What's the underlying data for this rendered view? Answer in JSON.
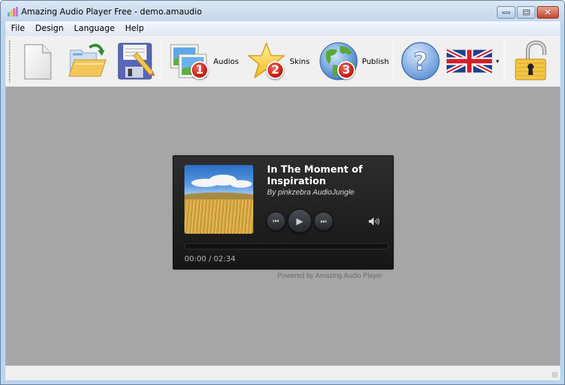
{
  "window": {
    "title": "Amazing Audio Player Free - demo.amaudio",
    "controls": {
      "minimize": "minimize",
      "maximize": "maximize",
      "close": "close"
    }
  },
  "menu": {
    "items": [
      {
        "label": "File"
      },
      {
        "label": "Design"
      },
      {
        "label": "Language"
      },
      {
        "label": "Help"
      }
    ]
  },
  "toolbar": {
    "new_icon": "new-document-icon",
    "open_icon": "open-folder-icon",
    "save_icon": "save-floppy-icon",
    "steps": [
      {
        "label": "Audios",
        "badge": "1",
        "icon": "images-icon"
      },
      {
        "label": "Skins",
        "badge": "2",
        "icon": "star-icon"
      },
      {
        "label": "Publish",
        "badge": "3",
        "icon": "globe-icon"
      }
    ],
    "help_icon": "help-icon",
    "language_icon": "uk-flag-icon",
    "lock_icon": "unlock-icon"
  },
  "player": {
    "title": "In The Moment of Inspiration",
    "artist": "By pinkzebra AudioJungle",
    "current_time": "00:00",
    "separator": " / ",
    "duration": "02:34",
    "progress": 0,
    "prev_glyph": "⏮",
    "play_glyph": "▶",
    "next_glyph": "⏭",
    "volume_glyph": "🔊",
    "powered_by": "Powered by Amazing Audio Player"
  },
  "colors": {
    "canvas_bg": "#a6a6a6",
    "player_bg": "#1f1f1f",
    "badge_red": "#c2140c"
  }
}
